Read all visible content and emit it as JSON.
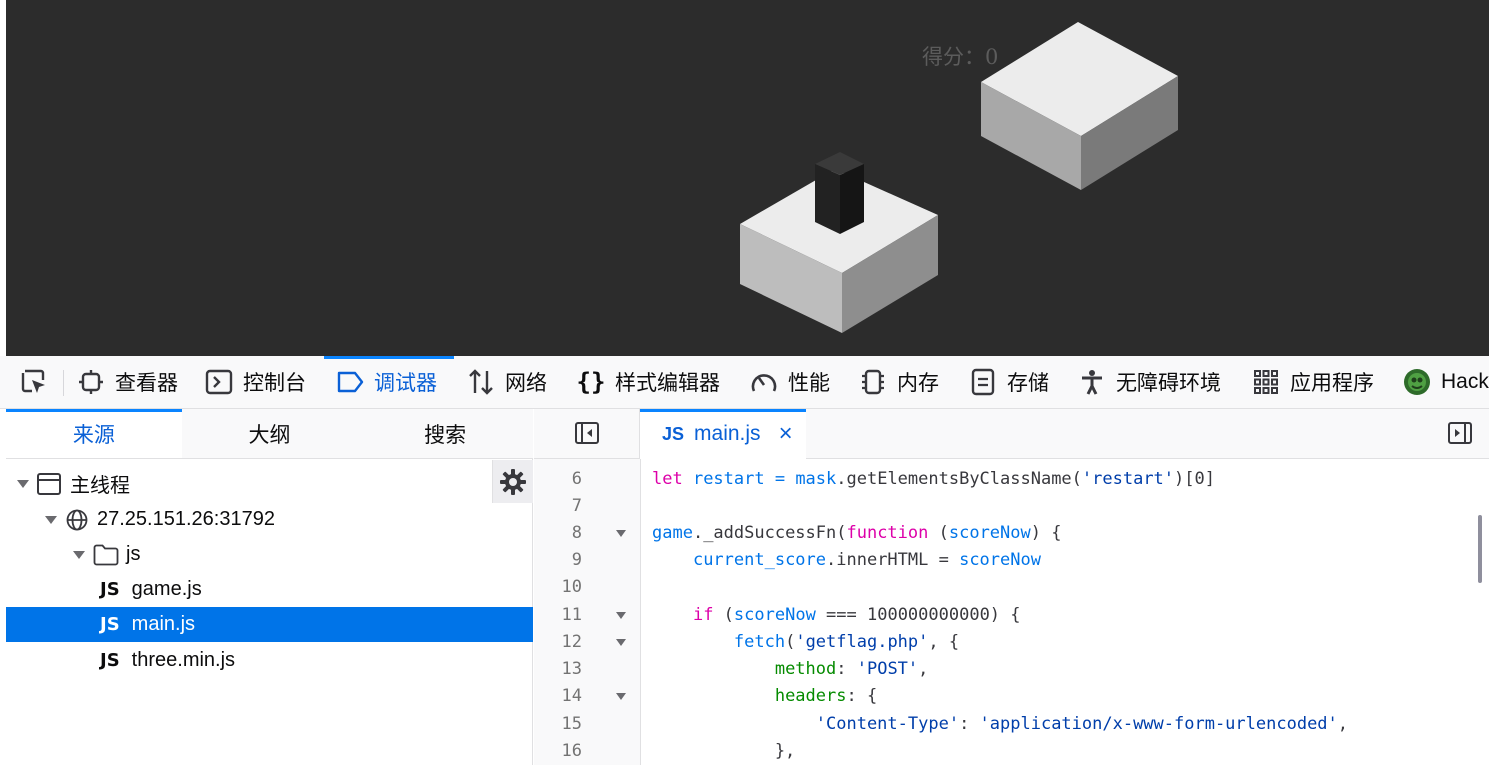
{
  "game": {
    "score_label": "得分：0"
  },
  "toolbar": {
    "tabs": [
      {
        "label": "查看器",
        "icon": "inspector-icon"
      },
      {
        "label": "控制台",
        "icon": "console-icon"
      },
      {
        "label": "调试器",
        "icon": "debugger-icon",
        "selected": true
      },
      {
        "label": "网络",
        "icon": "network-icon"
      },
      {
        "label": "样式编辑器",
        "icon": "style-editor-icon"
      },
      {
        "label": "性能",
        "icon": "performance-icon"
      },
      {
        "label": "内存",
        "icon": "memory-icon"
      },
      {
        "label": "存储",
        "icon": "storage-icon"
      },
      {
        "label": "无障碍环境",
        "icon": "accessibility-icon"
      },
      {
        "label": "应用程序",
        "icon": "application-icon"
      },
      {
        "label": "Hack",
        "icon": "hackbar-icon"
      }
    ]
  },
  "sources": {
    "tabs": [
      "来源",
      "大纲",
      "搜索"
    ],
    "tree": [
      {
        "label": "主线程",
        "level": 0,
        "kind": "thread"
      },
      {
        "label": "27.25.151.26:31792",
        "level": 1,
        "kind": "host"
      },
      {
        "label": "js",
        "level": 2,
        "kind": "folder"
      },
      {
        "label": "game.js",
        "level": 3,
        "kind": "file"
      },
      {
        "label": "main.js",
        "level": 3,
        "kind": "file",
        "selected": true
      },
      {
        "label": "three.min.js",
        "level": 3,
        "kind": "file"
      }
    ],
    "js_badge": "JS"
  },
  "editor": {
    "tab_label": "main.js",
    "tab_badge": "JS",
    "close_glyph": "×",
    "lines": [
      {
        "n": "6",
        "fold": false
      },
      {
        "n": "7",
        "fold": false
      },
      {
        "n": "8",
        "fold": true
      },
      {
        "n": "9",
        "fold": false
      },
      {
        "n": "10",
        "fold": false
      },
      {
        "n": "11",
        "fold": true
      },
      {
        "n": "12",
        "fold": true
      },
      {
        "n": "13",
        "fold": false
      },
      {
        "n": "14",
        "fold": true
      },
      {
        "n": "15",
        "fold": false
      },
      {
        "n": "16",
        "fold": false
      }
    ],
    "code": {
      "l6_kw": "let",
      "l6_a": " restart = ",
      "l6_b": "mask",
      "l6_c": ".getElementsByClassName(",
      "l6_str": "'restart'",
      "l6_d": ")[0]",
      "l8_a": "game",
      "l8_b": "._addSuccessFn(",
      "l8_kw": "function",
      "l8_c": " (",
      "l8_param": "scoreNow",
      "l8_d": ") {",
      "l9_a": "    ",
      "l9_b": "current_score",
      "l9_c": ".innerHTML = ",
      "l9_d": "scoreNow",
      "l11_a": "    ",
      "l11_kw": "if",
      "l11_b": " (",
      "l11_c": "scoreNow",
      "l11_d": " === 100000000000) {",
      "l12_a": "        ",
      "l12_b": "fetch",
      "l12_c": "(",
      "l12_str": "'getflag.php'",
      "l12_d": ", {",
      "l13_a": "            ",
      "l13_prop": "method",
      "l13_b": ": ",
      "l13_str": "'POST'",
      "l13_c": ",",
      "l14_a": "            ",
      "l14_prop": "headers",
      "l14_b": ": {",
      "l15_a": "                ",
      "l15_key": "'Content-Type'",
      "l15_b": ": ",
      "l15_str": "'application/x-www-form-urlencoded'",
      "l15_c": ",",
      "l16_a": "            },"
    }
  }
}
